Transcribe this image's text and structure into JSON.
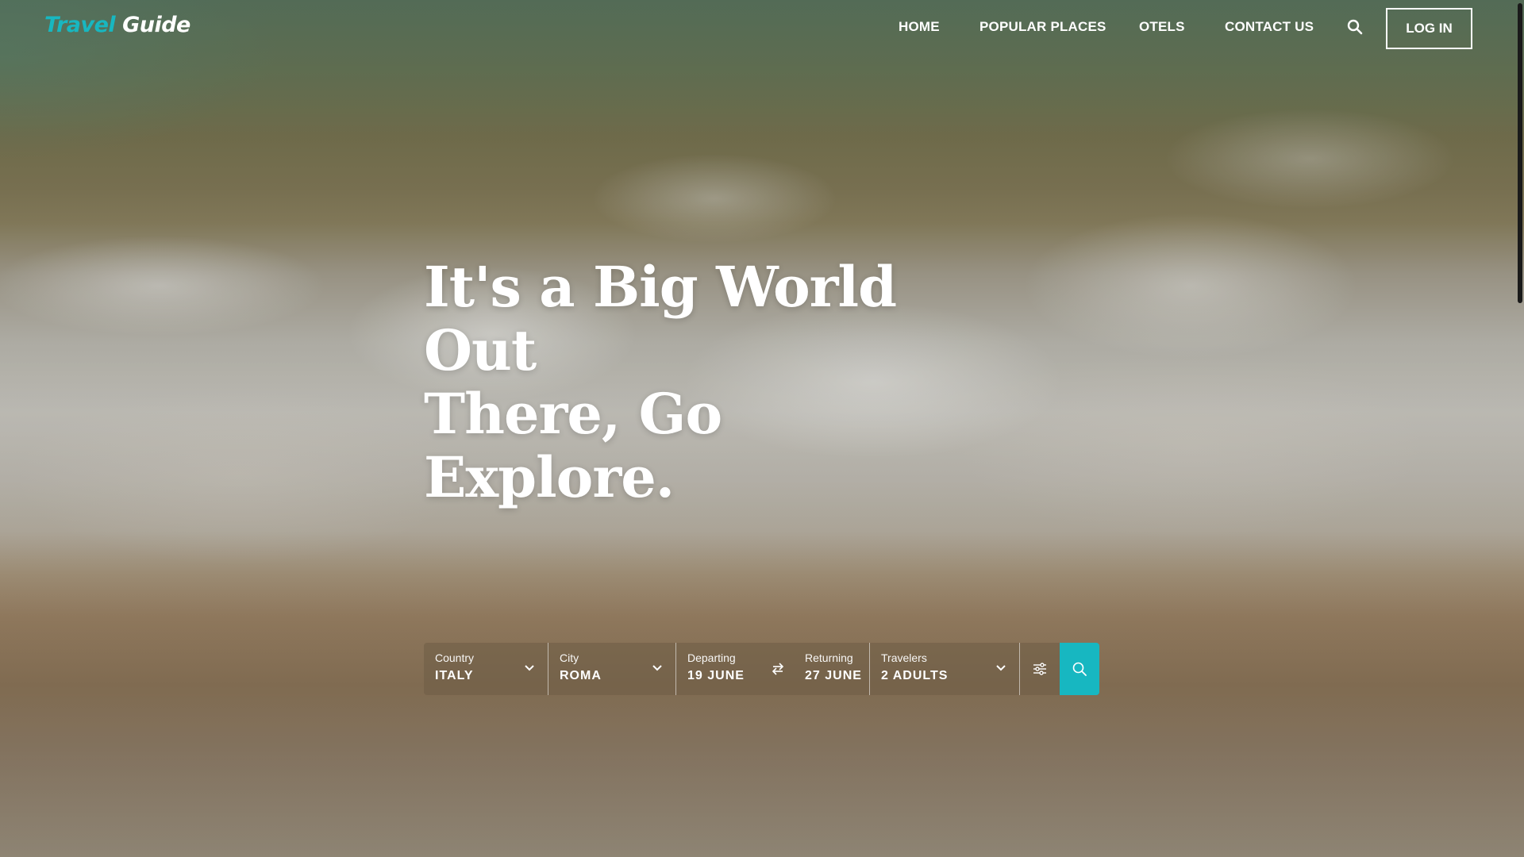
{
  "logo": {
    "part1": "Travel",
    "part2": "Guide"
  },
  "nav": {
    "items": [
      {
        "label": "HOME"
      },
      {
        "label": "POPULAR PLACES"
      },
      {
        "label": "OTELS"
      },
      {
        "label": "CONTACT US"
      }
    ],
    "search_icon": "search-icon",
    "login_label": "LOG IN"
  },
  "hero": {
    "headline_line1": "It's a Big World Out",
    "headline_line2": "There, Go Explore."
  },
  "search": {
    "country": {
      "label": "Country",
      "value": "ITALY"
    },
    "city": {
      "label": "City",
      "value": "ROMA"
    },
    "departing": {
      "label": "Departing",
      "value": "19 JUNE"
    },
    "returning": {
      "label": "Returning",
      "value": "27 JUNE"
    },
    "travelers": {
      "label": "Travelers",
      "value": "2 ADULTS"
    },
    "icons": {
      "swap": "swap-arrows-icon",
      "filter": "sliders-icon",
      "submit": "search-icon"
    }
  },
  "colors": {
    "accent": "#17b7c1",
    "text": "#ffffff"
  }
}
